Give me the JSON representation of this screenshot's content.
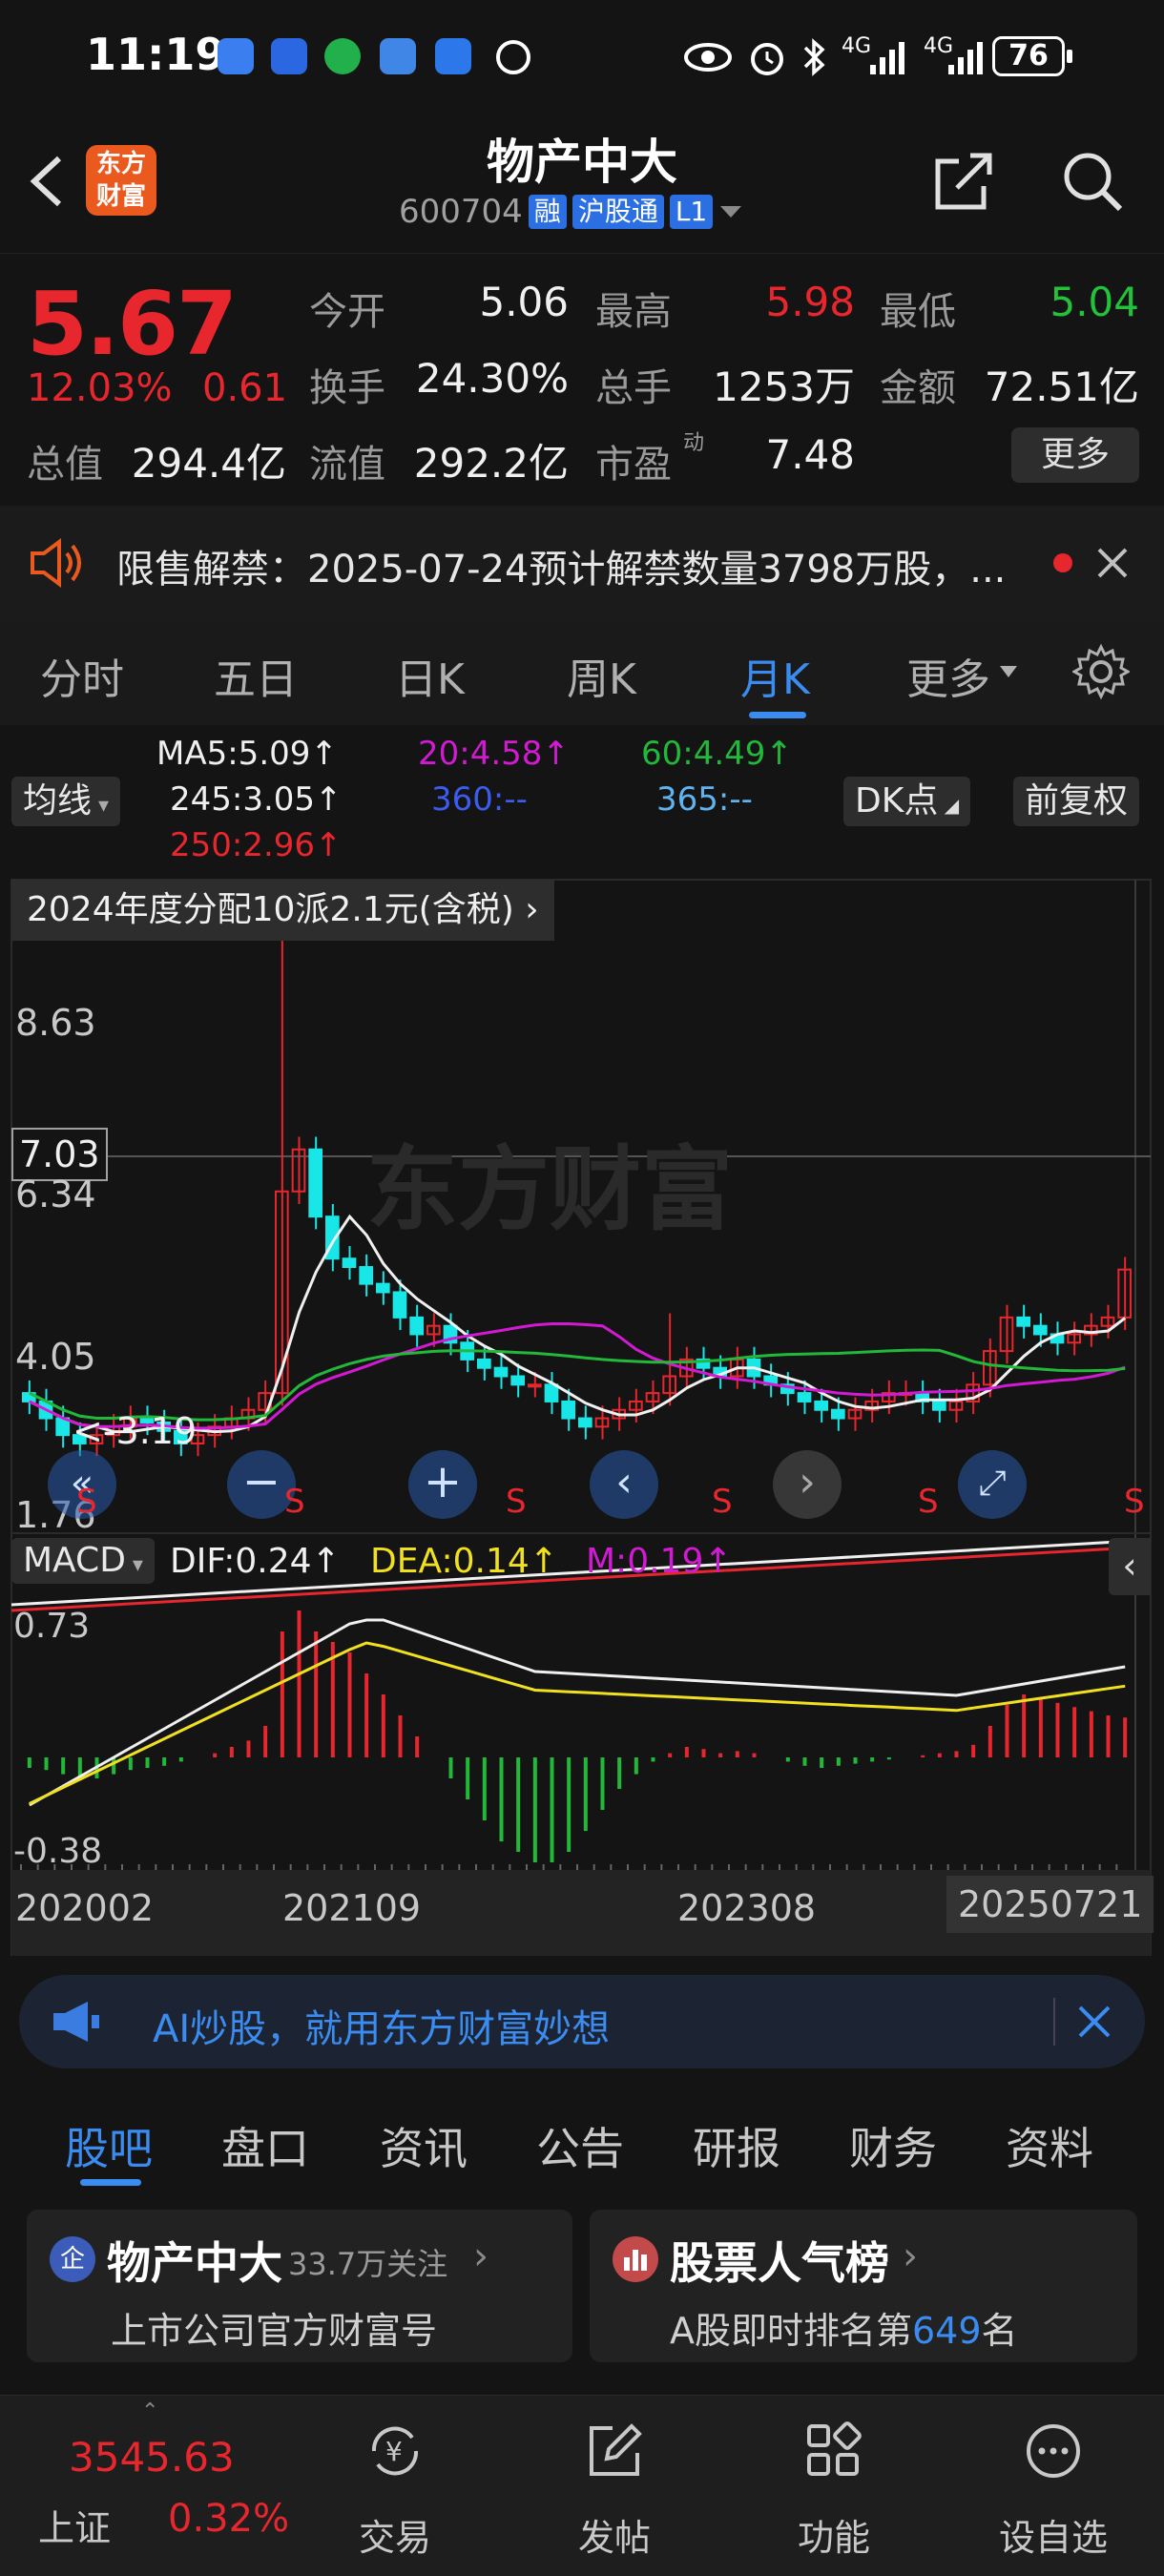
{
  "status_bar": {
    "time": "11:19",
    "signal_1": "4G",
    "signal_2": "4G",
    "battery": "76",
    "icons": [
      "arrow-up-app-icon",
      "tencent-app-icon",
      "wechat-icon",
      "message-icon",
      "feishu-icon",
      "vpn-icon",
      "eye-icon",
      "alarm-icon",
      "bluetooth-icon"
    ]
  },
  "header": {
    "brand_logo": "东方\n财富",
    "stock_name": "物产中大",
    "stock_code": "600704",
    "tags": [
      "融",
      "沪股通",
      "L1"
    ]
  },
  "quote": {
    "price": "5.67",
    "change_pct": "12.03%",
    "change_amt": "0.61",
    "fields": [
      {
        "label": "今开",
        "value": "5.06",
        "tone": "white"
      },
      {
        "label": "最高",
        "value": "5.98",
        "tone": "red"
      },
      {
        "label": "最低",
        "value": "5.04",
        "tone": "green"
      },
      {
        "label": "换手",
        "value": "24.30%",
        "tone": "white"
      },
      {
        "label": "总手",
        "value": "1253万",
        "tone": "white"
      },
      {
        "label": "金额",
        "value": "72.51亿",
        "tone": "white"
      },
      {
        "label": "总值",
        "value": "294.4亿",
        "tone": "white"
      },
      {
        "label": "流值",
        "value": "292.2亿",
        "tone": "white"
      },
      {
        "label": "市盈",
        "value": "7.48",
        "tone": "white"
      }
    ],
    "pe_superscript": "动",
    "more_label": "更多"
  },
  "notice": {
    "text": "限售解禁：2025-07-24预计解禁数量3798万股，..."
  },
  "period_tabs": [
    "分时",
    "五日",
    "日K",
    "周K",
    "月K",
    "更多"
  ],
  "period_active": 4,
  "indicators": {
    "ma_select": "均线",
    "ma5": "MA5:5.09↑",
    "ma20": "20:4.58↑",
    "ma60": "60:4.49↑",
    "ma245": "245:3.05↑",
    "ma360": "360:--",
    "ma365": "365:--",
    "ma250": "250:2.96↑",
    "dk_label": "DK点",
    "adjust_label": "前复权",
    "dividend_note": "2024年度分配10派2.1元(含税)",
    "macd_select": "MACD",
    "dif": "DIF:0.24↑",
    "dea": "DEA:0.14↑",
    "m": "M:0.19↑"
  },
  "chart_data": {
    "type": "candlestick",
    "watermark": "东方财富",
    "price_ticks": [
      "8.63",
      "7.03",
      "6.34",
      "4.05",
      "1.76"
    ],
    "min_label": "<-3.19",
    "macd_ticks": [
      "0.73",
      "-0.38"
    ],
    "x_ticks": [
      "202002",
      "202109",
      "202308",
      "20250721"
    ],
    "signal_markers": [
      "S",
      "S",
      "S",
      "S",
      "S",
      "S"
    ],
    "colors": {
      "up": "#e8262d",
      "down": "#19e6e6",
      "ma5": "#f0f0f0",
      "ma20": "#d21ad2",
      "ma60": "#22b83a",
      "ma245": "#f0f0f0",
      "ma250": "#e8262d",
      "dea": "#f0e020"
    }
  },
  "ai_banner": {
    "text": "AI炒股，就用东方财富妙想"
  },
  "content_tabs": [
    "股吧",
    "盘口",
    "资讯",
    "公告",
    "研报",
    "财务",
    "资料"
  ],
  "content_active": 0,
  "cards": {
    "company": {
      "badge": "企",
      "name": "物产中大",
      "followers": "33.7万关注",
      "subtitle": "上市公司官方财富号"
    },
    "rank": {
      "title": "股票人气榜",
      "subtitle_prefix": "A股即时排名第",
      "rank": "649",
      "subtitle_suffix": "名"
    }
  },
  "bottom_nav": {
    "index_value": "3545.63",
    "index_name": "上证",
    "index_change": "0.32%",
    "items": [
      "交易",
      "发帖",
      "功能",
      "设自选"
    ]
  }
}
